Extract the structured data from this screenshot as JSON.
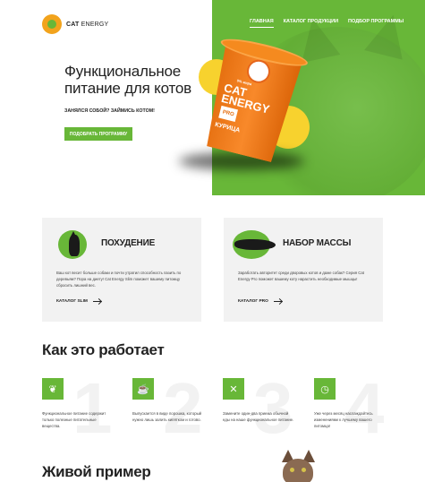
{
  "header": {
    "logo_brand": "CAT",
    "logo_brand_light": "ENERGY",
    "nav": [
      {
        "label": "ГЛАВНАЯ",
        "active": true
      },
      {
        "label": "КАТАЛОГ ПРОДУКЦИИ",
        "active": false
      },
      {
        "label": "ПОДБОР ПРОГРАММЫ",
        "active": false
      }
    ]
  },
  "hero": {
    "title_line1": "Функциональное",
    "title_line2": "питание для котов",
    "subtitle": "ЗАНЯЛСЯ СОБОЙ? ЗАЙМИСЬ КОТОМ!",
    "button": "ПОДОБРАТЬ ПРОГРАММУ",
    "product": {
      "tag": "0% жира",
      "brand_line1": "CAT",
      "brand_line2": "ENERGY",
      "pro": "PRO",
      "flavor": "КУРИЦА"
    }
  },
  "programs": [
    {
      "title": "ПОХУДЕНИЕ",
      "text": "Ваш кот весит больше собаки и почти утратил способность пазить по деревьям? Пора на диету! Cat Energy Slim поможет вашему питомцу сбросить лишний вес.",
      "link": "КАТАЛОГ SLIM"
    },
    {
      "title": "НАБОР МАССЫ",
      "text": "Заработать авторитет среди дворовых котов и даже собак? Серия Cat Energy Pro поможет вашему коту нарастить необходимые мышцы!",
      "link": "КАТАЛОГ PRO"
    }
  ],
  "how": {
    "title": "Как это работает",
    "steps": [
      {
        "num": "1",
        "text": "Функциональное питание содержит только полезные питательные вещества."
      },
      {
        "num": "2",
        "text": "Выпускается в виде порошка, который нужно лишь залить кипятком и готово."
      },
      {
        "num": "3",
        "text": "Замените один-два приема обычной еды на наше функциональное питание."
      },
      {
        "num": "4",
        "text": "Уже через месяц наслаждайтесь изменениями к лучшему вашего питомца!"
      }
    ]
  },
  "live": {
    "title": "Живой пример"
  },
  "colors": {
    "accent": "#68b738",
    "product_orange": "#f58a1f",
    "yellow": "#f7d22e"
  }
}
